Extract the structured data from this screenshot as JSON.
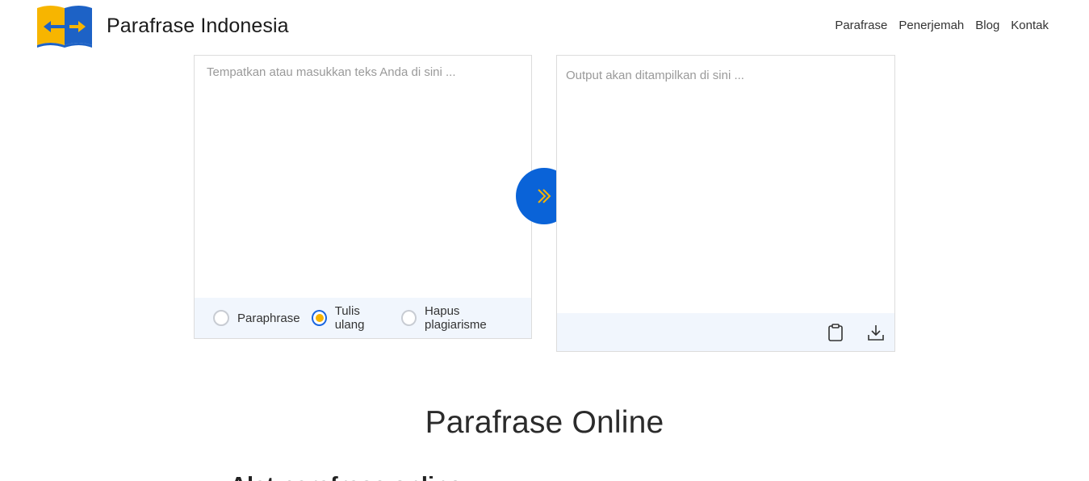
{
  "brand": {
    "name": "Parafrase Indonesia",
    "logo_icon": "book-arrows-icon"
  },
  "nav": {
    "items": [
      "Parafrase",
      "Penerjemah",
      "Blog",
      "Kontak"
    ]
  },
  "input": {
    "placeholder": "Tempatkan atau masukkan teks Anda di sini ..."
  },
  "modes": {
    "options": [
      "Paraphrase",
      "Tulis ulang",
      "Hapus plagiarisme"
    ],
    "selected": "Tulis ulang"
  },
  "output": {
    "placeholder": "Output akan ditampilkan di sini ..."
  },
  "actions": {
    "submit_icon": "double-chevron-right-icon",
    "copy_icon": "clipboard-icon",
    "download_icon": "download-icon"
  },
  "content": {
    "title": "Parafrase Online",
    "subtitle": "Alat parafrase online"
  },
  "colors": {
    "accent": "#0a63d8",
    "radio_dot": "#f6b300",
    "logo_yellow": "#f7b500",
    "logo_blue": "#1d62c6",
    "panel_bar": "#f1f6fd"
  }
}
